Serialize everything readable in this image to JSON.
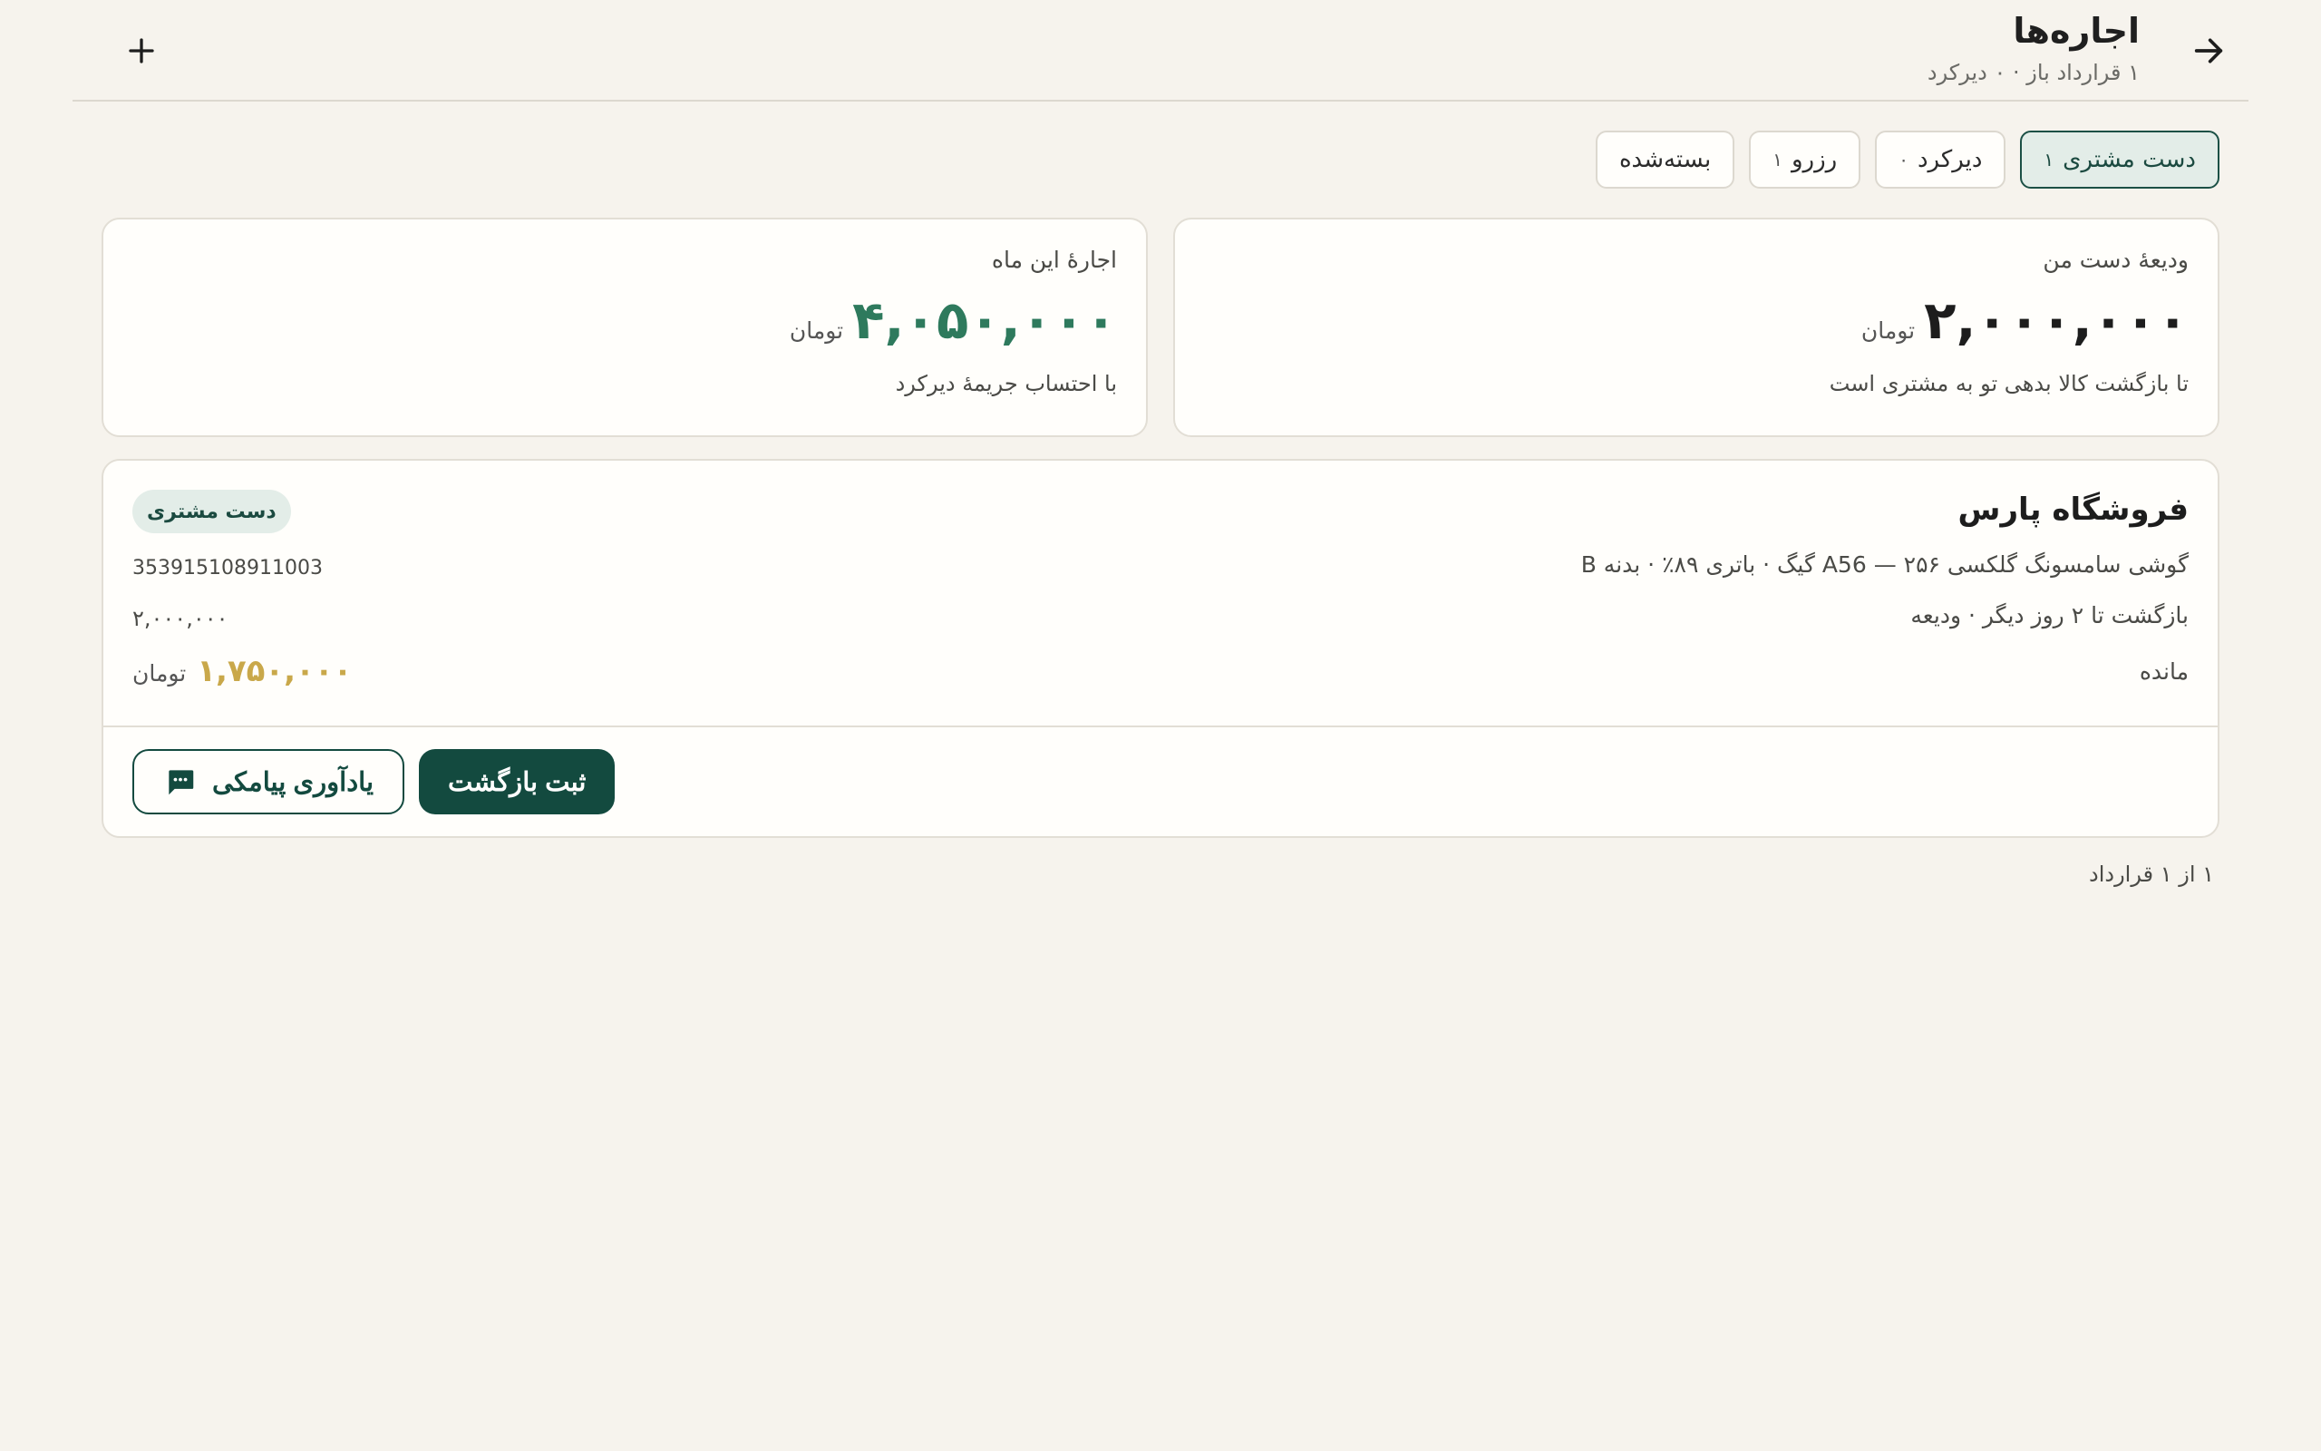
{
  "header": {
    "title": "اجاره‌ها",
    "subtitle": "۱ قرارداد باز · ۰ دیرکرد",
    "back_icon": "arrow-right-icon",
    "add_icon": "plus-icon"
  },
  "filters": [
    {
      "label": "دست مشتری",
      "count": "۱",
      "active": true
    },
    {
      "label": "دیرکرد",
      "count": "۰",
      "active": false
    },
    {
      "label": "رزرو",
      "count": "۱",
      "active": false
    },
    {
      "label": "بسته‌شده",
      "count": "",
      "active": false
    }
  ],
  "stats": {
    "deposit": {
      "label": "ودیعهٔ دست من",
      "value": "۲,۰۰۰,۰۰۰",
      "unit": "تومان",
      "note": "تا بازگشت کالا بدهی تو به مشتری است"
    },
    "rent": {
      "label": "اجارهٔ این ماه",
      "value": "۴,۰۵۰,۰۰۰",
      "unit": "تومان",
      "note": "با احتساب جریمهٔ دیرکرد"
    }
  },
  "contract": {
    "store": "فروشگاه پارس",
    "device": "گوشی سامسونگ گلکسی A56 — ۲۵۶ گیگ · باتری ۸۹٪ · بدنه B",
    "return_info": "بازگشت تا ۲ روز دیگر · ودیعه",
    "remaining_label": "مانده",
    "status": "دست مشتری",
    "imei": "353915108911003",
    "deposit_amount": "۲,۰۰۰,۰۰۰",
    "remaining_value": "۱,۷۵۰,۰۰۰",
    "remaining_unit": "تومان",
    "primary_action": "ثبت بازگشت",
    "secondary_action": "یادآوری پیامکی",
    "secondary_icon": "sms-icon"
  },
  "pager": "۱ از ۱ قرارداد",
  "colors": {
    "accent": "#134a3f",
    "accent_light": "#e3ede8",
    "rent_value": "#2e7a5d",
    "remaining_value": "#c9a84a",
    "background": "#f6f3ed"
  }
}
